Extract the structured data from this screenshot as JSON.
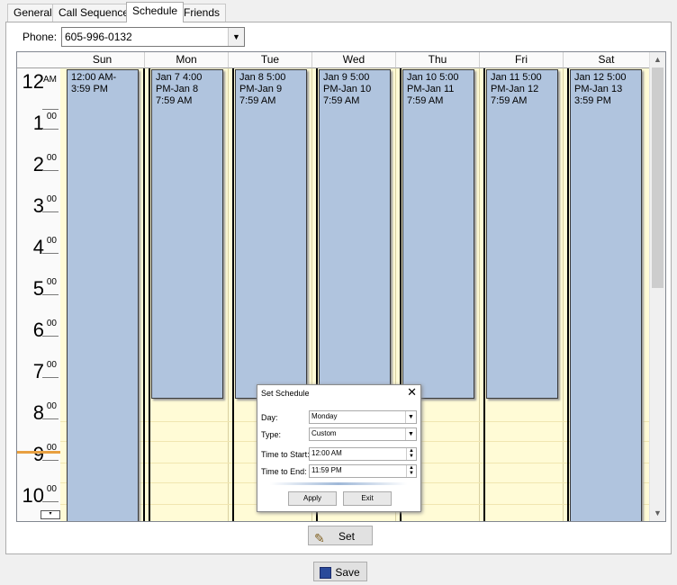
{
  "tabs": [
    {
      "label": "General"
    },
    {
      "label": "Call Sequence"
    },
    {
      "label": "Schedule"
    },
    {
      "label": "Friends"
    }
  ],
  "phone": {
    "label": "Phone:",
    "value": "605-996-0132"
  },
  "days": [
    "Sun",
    "Mon",
    "Tue",
    "Wed",
    "Thu",
    "Fri",
    "Sat"
  ],
  "hours": [
    {
      "num": "12",
      "sub": "AM"
    },
    {
      "num": "1",
      "sub": "00"
    },
    {
      "num": "2",
      "sub": "00"
    },
    {
      "num": "3",
      "sub": "00"
    },
    {
      "num": "4",
      "sub": "00"
    },
    {
      "num": "5",
      "sub": "00"
    },
    {
      "num": "6",
      "sub": "00"
    },
    {
      "num": "7",
      "sub": "00"
    },
    {
      "num": "8",
      "sub": "00"
    },
    {
      "num": "9",
      "sub": "00"
    },
    {
      "num": "10",
      "sub": "00"
    }
  ],
  "events": [
    {
      "text": "12:00 AM-3:59 PM"
    },
    {
      "text": "Jan 7 4:00 PM-Jan 8 7:59 AM"
    },
    {
      "text": "Jan 8 5:00 PM-Jan 9 7:59 AM"
    },
    {
      "text": "Jan 9 5:00 PM-Jan 10 7:59 AM"
    },
    {
      "text": "Jan 10 5:00 PM-Jan 11 7:59 AM"
    },
    {
      "text": "Jan 11 5:00 PM-Jan 12 7:59 AM"
    },
    {
      "text": "Jan 12 5:00 PM-Jan 13 3:59 PM"
    }
  ],
  "dialog": {
    "title": "Set Schedule",
    "close": "✕",
    "day_label": "Day:",
    "day_value": "Monday",
    "type_label": "Type:",
    "type_value": "Custom",
    "start_label": "Time to Start:",
    "start_value": "12:00 AM",
    "end_label": "Time to End:",
    "end_value": "11:59 PM",
    "apply": "Apply",
    "exit": "Exit"
  },
  "set_button": "Set",
  "save_button": "Save",
  "colors": {
    "event": "#b0c4de",
    "work_hours": "#fffbd6",
    "current_time": "#e8a040"
  }
}
